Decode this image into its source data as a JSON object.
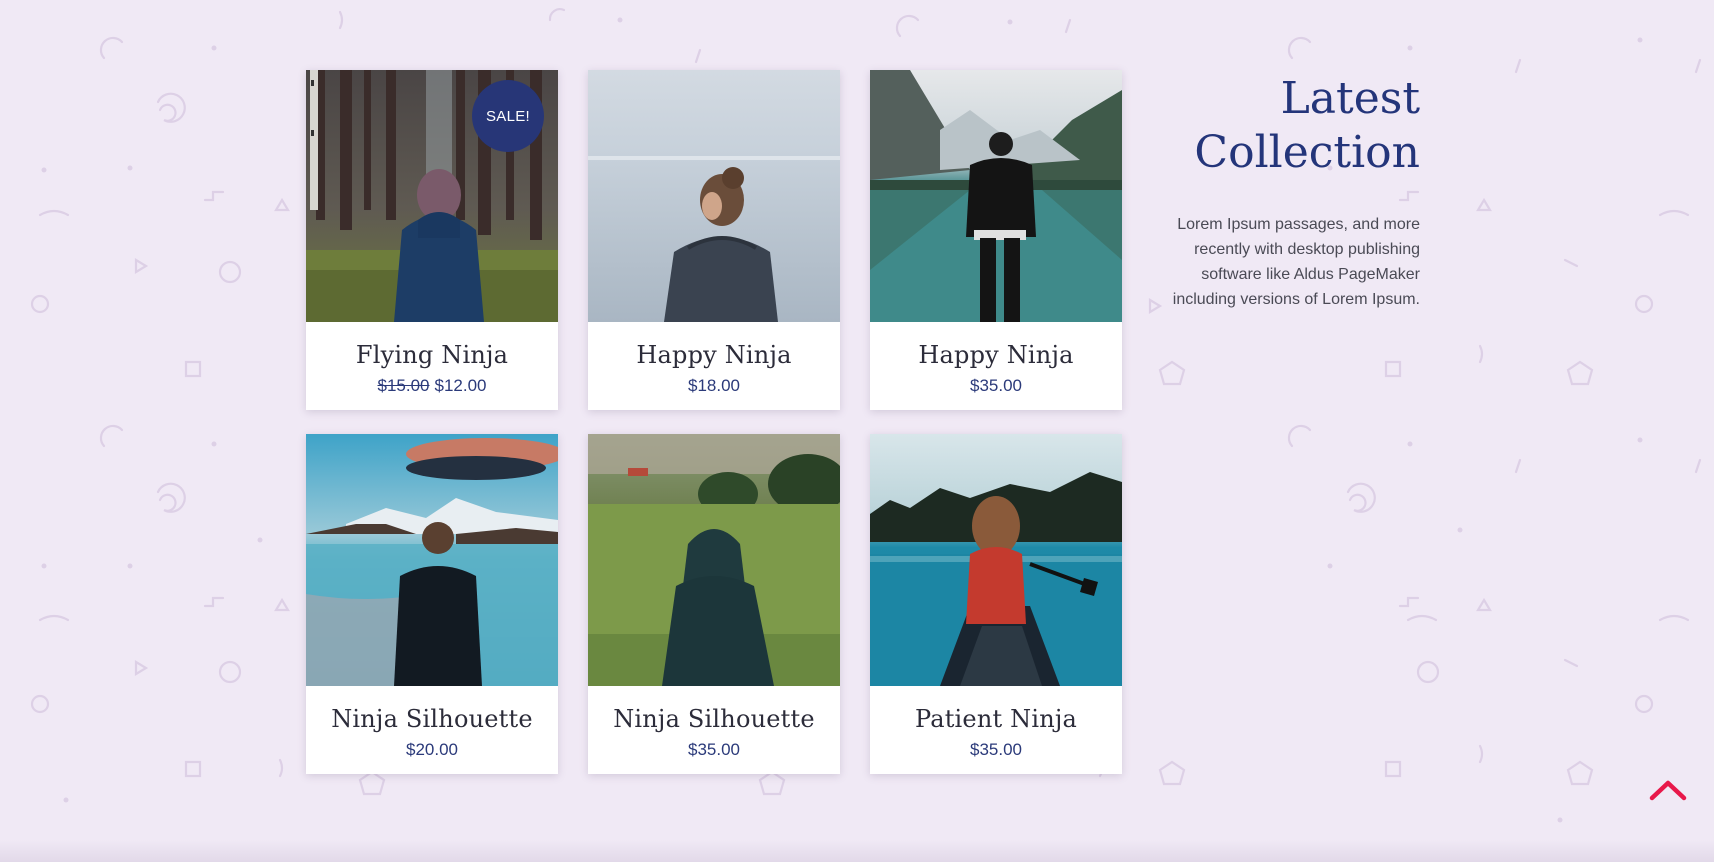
{
  "colors": {
    "background": "#f0e9f5",
    "accent_navy": "#24357a",
    "sale_badge": "#273677",
    "back_to_top": "#e8184a"
  },
  "products": [
    {
      "name": "Flying Ninja",
      "price_old": "$15.00",
      "price": "$12.00",
      "badge": "SALE!",
      "image": "woman-in-forest-photo"
    },
    {
      "name": "Happy Ninja",
      "price": "$18.00",
      "image": "woman-by-misty-lake-photo"
    },
    {
      "name": "Happy Ninja",
      "price": "$35.00",
      "image": "man-at-mountain-lake-photo"
    },
    {
      "name": "Ninja Silhouette",
      "price": "$20.00",
      "image": "man-at-reflective-lake-photo"
    },
    {
      "name": "Ninja Silhouette",
      "price": "$35.00",
      "image": "hooded-person-in-field-photo"
    },
    {
      "name": "Patient Ninja",
      "price": "$35.00",
      "image": "woman-in-canoe-photo"
    }
  ],
  "sidebar": {
    "title": "Latest Collection",
    "description": "Lorem Ipsum passages, and more recently with desktop publishing software like Aldus PageMaker including versions of Lorem Ipsum."
  },
  "back_to_top_icon": "chevron-up-icon"
}
